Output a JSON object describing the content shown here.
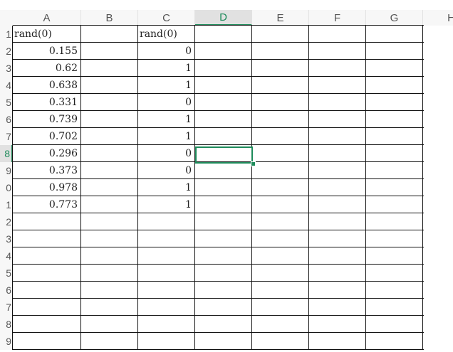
{
  "sheet": {
    "columns": [
      "A",
      "B",
      "C",
      "D",
      "E",
      "F",
      "G",
      "H"
    ],
    "active_column": "D",
    "row_numbers": [
      "1",
      "2",
      "3",
      "4",
      "5",
      "6",
      "7",
      "8",
      "9",
      "0",
      "1",
      "2",
      "3",
      "4",
      "5",
      "6",
      "7",
      "8",
      "9"
    ],
    "active_row_index": 7,
    "cells": {
      "A": [
        "rand(0)",
        "0.155",
        "0.62",
        "0.638",
        "0.331",
        "0.739",
        "0.702",
        "0.296",
        "0.373",
        "0.978",
        "0.773"
      ],
      "C": [
        "rand(0)",
        "0",
        "1",
        "1",
        "0",
        "1",
        "1",
        "0",
        "0",
        "1",
        "1"
      ]
    },
    "selected_cell": "D8"
  }
}
